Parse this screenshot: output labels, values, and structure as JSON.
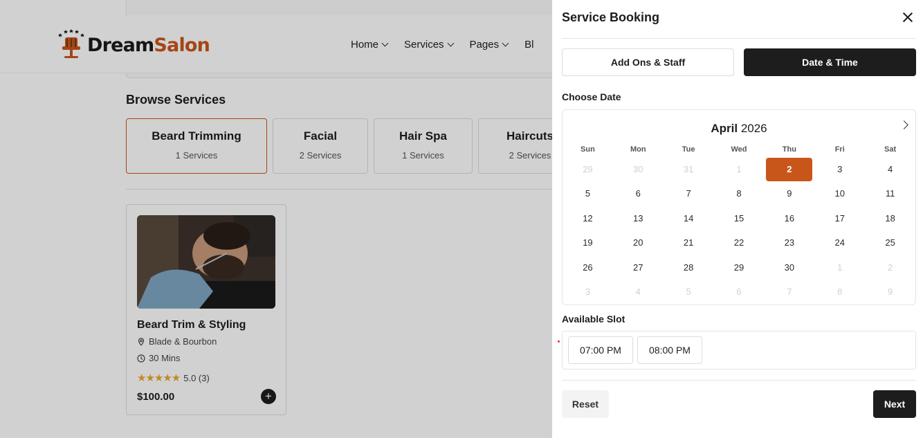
{
  "header": {
    "logo_dream": "Dream",
    "logo_salon": "Salon",
    "nav": [
      {
        "label": "Home"
      },
      {
        "label": "Services"
      },
      {
        "label": "Pages"
      },
      {
        "label": "Bl"
      }
    ]
  },
  "browse": {
    "title": "Browse Services",
    "categories": [
      {
        "name": "Beard Trimming",
        "count": "1 Services"
      },
      {
        "name": "Facial",
        "count": "2 Services"
      },
      {
        "name": "Hair Spa",
        "count": "1 Services"
      },
      {
        "name": "Haircuts",
        "count": "2 Services"
      }
    ]
  },
  "service_card": {
    "name": "Beard Trim & Styling",
    "location": "Blade & Bourbon",
    "duration": "30 Mins",
    "stars": "★★★★★",
    "rating": "5.0 (3)",
    "price": "$100.00"
  },
  "drawer": {
    "title": "Service Booking",
    "tabs": [
      {
        "label": "Add Ons & Staff"
      },
      {
        "label": "Date & Time"
      }
    ],
    "choose_date_label": "Choose Date",
    "calendar": {
      "month": "April",
      "year": "2026",
      "weekdays": [
        "Sun",
        "Mon",
        "Tue",
        "Wed",
        "Thu",
        "Fri",
        "Sat"
      ],
      "days": [
        {
          "d": "29",
          "m": true
        },
        {
          "d": "30",
          "m": true
        },
        {
          "d": "31",
          "m": true
        },
        {
          "d": "1",
          "m": true
        },
        {
          "d": "2",
          "sel": true
        },
        {
          "d": "3"
        },
        {
          "d": "4"
        },
        {
          "d": "5"
        },
        {
          "d": "6"
        },
        {
          "d": "7"
        },
        {
          "d": "8"
        },
        {
          "d": "9"
        },
        {
          "d": "10"
        },
        {
          "d": "11"
        },
        {
          "d": "12"
        },
        {
          "d": "13"
        },
        {
          "d": "14"
        },
        {
          "d": "15"
        },
        {
          "d": "16"
        },
        {
          "d": "17"
        },
        {
          "d": "18"
        },
        {
          "d": "19"
        },
        {
          "d": "20"
        },
        {
          "d": "21"
        },
        {
          "d": "22"
        },
        {
          "d": "23"
        },
        {
          "d": "24"
        },
        {
          "d": "25"
        },
        {
          "d": "26"
        },
        {
          "d": "27"
        },
        {
          "d": "28"
        },
        {
          "d": "29"
        },
        {
          "d": "30"
        },
        {
          "d": "1",
          "m": true
        },
        {
          "d": "2",
          "m": true
        },
        {
          "d": "3",
          "m": true
        },
        {
          "d": "4",
          "m": true
        },
        {
          "d": "5",
          "m": true
        },
        {
          "d": "6",
          "m": true
        },
        {
          "d": "7",
          "m": true
        },
        {
          "d": "8",
          "m": true
        },
        {
          "d": "9",
          "m": true
        }
      ]
    },
    "available_slot_label": "Available Slot",
    "slots": [
      {
        "label": "07:00 PM"
      },
      {
        "label": "08:00 PM"
      }
    ],
    "reset_label": "Reset",
    "next_label": "Next"
  },
  "colors": {
    "accent": "#c8561a",
    "dark": "#1d1d1d",
    "star": "#f0a52b"
  }
}
